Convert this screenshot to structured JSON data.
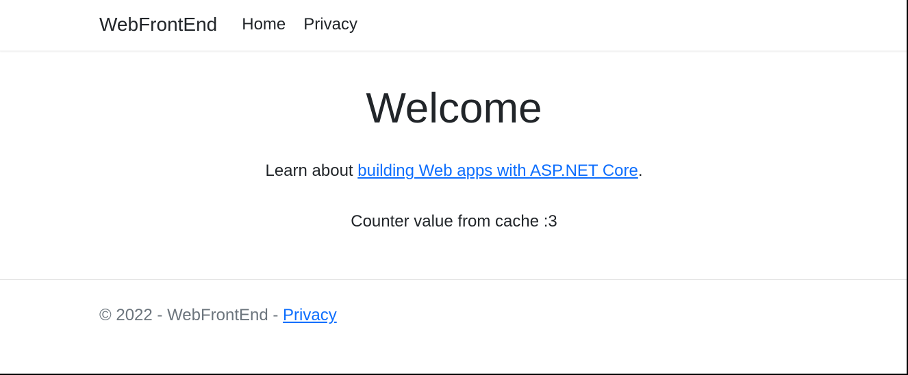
{
  "header": {
    "brand": "WebFrontEnd",
    "nav": [
      {
        "label": "Home"
      },
      {
        "label": "Privacy"
      }
    ]
  },
  "main": {
    "heading": "Welcome",
    "learn_prefix": "Learn about ",
    "learn_link": "building Web apps with ASP.NET Core",
    "learn_suffix": ".",
    "counter_prefix": "Counter value from cache :",
    "counter_value": "3"
  },
  "footer": {
    "copyright": "© 2022 - WebFrontEnd - ",
    "privacy_link": "Privacy"
  }
}
